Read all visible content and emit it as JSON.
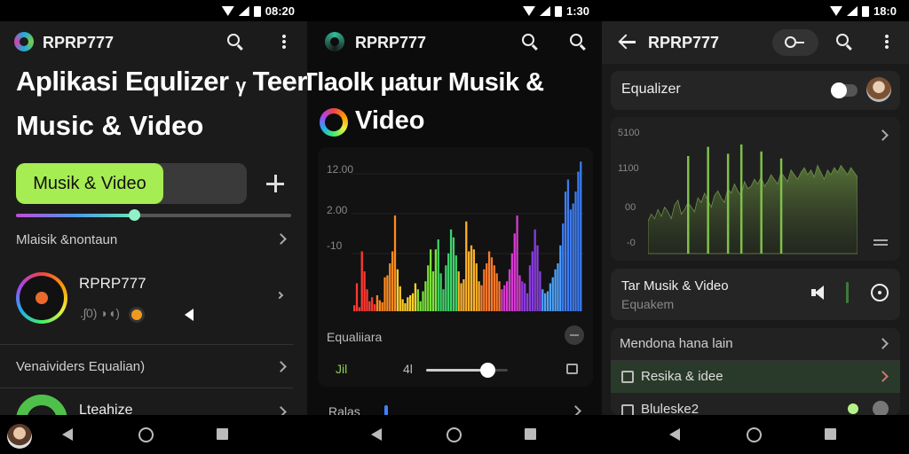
{
  "panel1": {
    "status_time": "08:20",
    "app_title": "RPRP777",
    "headline_line1": "Aplikasi Equlizer ᵧ Teer",
    "headline_line2": "Music & Video",
    "tab_active": "Musik & Video",
    "slider_value": 0.43,
    "section1": "Mlaisik &nontaun",
    "track_title": "RPRP777",
    "track_sub": ".ʃ0) ◗◖)",
    "section2": "Venaividers Equalian)",
    "item3": "Lteahize"
  },
  "panel2": {
    "status_time": "1:30",
    "app_title": "RPRP777",
    "headline_overlap": "Tlaolk µatur Musik &",
    "headline_line2": "Video",
    "yticks": [
      "12.00",
      "2.00",
      "-10"
    ],
    "chart_data": {
      "type": "bar",
      "values": [
        6,
        28,
        4,
        60,
        40,
        22,
        10,
        14,
        7,
        16,
        11,
        9,
        34,
        36,
        48,
        60,
        96,
        42,
        25,
        12,
        8,
        14,
        16,
        18,
        28,
        22,
        10,
        20,
        30,
        46,
        62,
        40,
        62,
        72,
        38,
        22,
        46,
        58,
        82,
        74,
        56,
        40,
        28,
        32,
        90,
        60,
        66,
        62,
        48,
        30,
        26,
        42,
        48,
        60,
        54,
        46,
        38,
        30,
        22,
        26,
        30,
        42,
        58,
        78,
        96,
        36,
        30,
        28,
        18,
        46,
        60,
        82,
        66,
        40,
        22,
        18,
        20,
        28,
        34,
        42,
        48,
        66,
        88,
        120,
        132,
        102,
        108,
        120,
        140,
        150
      ],
      "colors": [
        "#ff3a33",
        "#ff8a1e",
        "#ffd12a",
        "#7be33a",
        "#3ed36a",
        "#ffb22a",
        "#ff7a2a",
        "#d83bd3",
        "#8b3de0",
        "#4da3ff",
        "#3d7cf2"
      ],
      "ylim": [
        0,
        160
      ]
    },
    "eq_label": "Equaliiara",
    "eq_left": "Jil",
    "eq_value": "4l",
    "eq_slider": 0.75,
    "bottom_label": "Ralas"
  },
  "panel3": {
    "status_time": "18:0",
    "app_title": "RPRP777",
    "equalizer_label": "Equalizer",
    "yticks": [
      "5100",
      "1100",
      "00",
      "-0"
    ],
    "chart_data": {
      "type": "area",
      "ylim": [
        0,
        110
      ],
      "values": [
        28,
        34,
        30,
        38,
        32,
        40,
        36,
        30,
        42,
        46,
        34,
        38,
        44,
        40,
        36,
        48,
        44,
        52,
        46,
        40,
        50,
        54,
        48,
        44,
        56,
        52,
        60,
        54,
        50,
        62,
        56,
        58,
        64,
        60,
        66,
        58,
        62,
        68,
        64,
        60,
        70,
        66,
        62,
        72,
        68,
        64,
        70,
        74,
        68,
        72,
        66,
        76,
        70,
        64,
        72,
        68,
        74,
        70,
        76,
        72,
        68,
        74,
        70,
        66
      ],
      "spikes": [
        {
          "x": 12,
          "y": 84
        },
        {
          "x": 18,
          "y": 92
        },
        {
          "x": 24,
          "y": 86
        },
        {
          "x": 28,
          "y": 94
        },
        {
          "x": 34,
          "y": 88
        },
        {
          "x": 40,
          "y": 82
        }
      ]
    },
    "track_label": "Tar Musik & Video",
    "track_sub": "Equakem",
    "row1": "Mendona hana lain",
    "row2": "Resika & idee",
    "row3": "Bluleske2"
  }
}
